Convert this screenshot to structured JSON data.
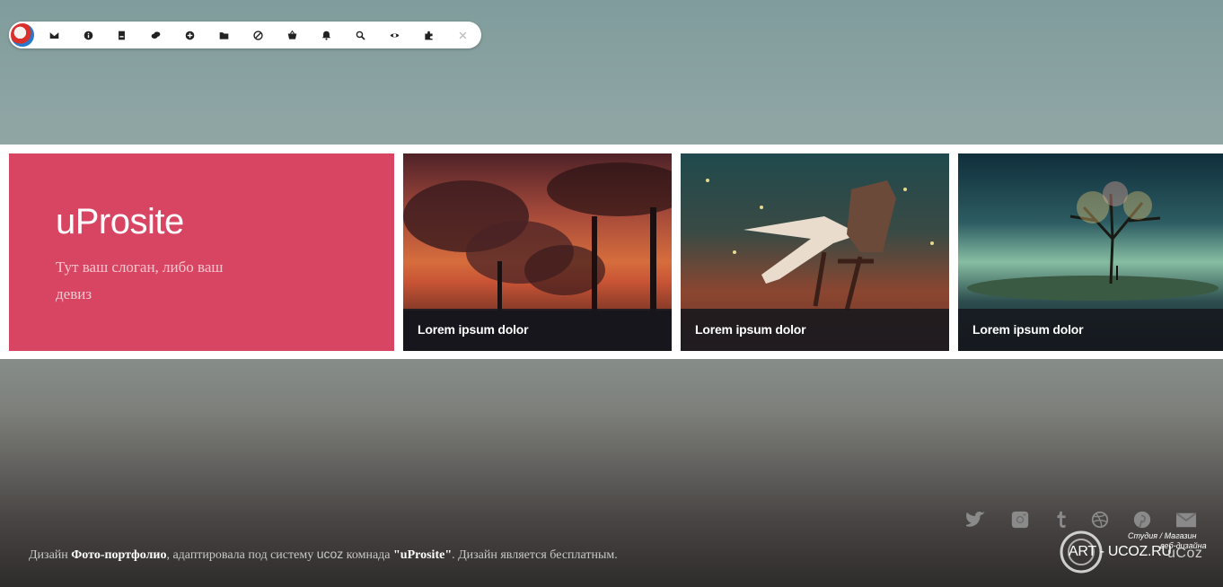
{
  "toolbar": {
    "icons": [
      "mail-icon",
      "info-icon",
      "document-icon",
      "chat-icon",
      "add-icon",
      "folder-icon",
      "block-icon",
      "shop-icon",
      "bell-icon",
      "search-icon",
      "eye-icon",
      "puzzle-icon",
      "close-icon"
    ]
  },
  "hero": {
    "title": "uProsite",
    "tagline": "Тут ваш слоган, либо ваш девиз",
    "background_color": "#d84562"
  },
  "cards": [
    {
      "caption": "Lorem ipsum dolor"
    },
    {
      "caption": "Lorem ipsum dolor"
    },
    {
      "caption": "Lorem ipsum dolor"
    }
  ],
  "footer": {
    "text_prefix": "Дизайн ",
    "design_name": "Фото-портфолио",
    "text_middle": ", адаптировала под систему ",
    "system": "ucoz",
    "text_team": " комнада ",
    "team": "\"uProsite\"",
    "text_suffix": ". Дизайн является бесплатным.",
    "social_icons": [
      "twitter-icon",
      "instagram-icon",
      "tumblr-icon",
      "dribbble-icon",
      "pinterest-icon",
      "email-icon"
    ],
    "studio_small_line1": "Студия / Магазин",
    "studio_small_line2": "веб-дизайна",
    "studio_main": "ART - UCOZ.RU",
    "brand": "uCoz"
  }
}
